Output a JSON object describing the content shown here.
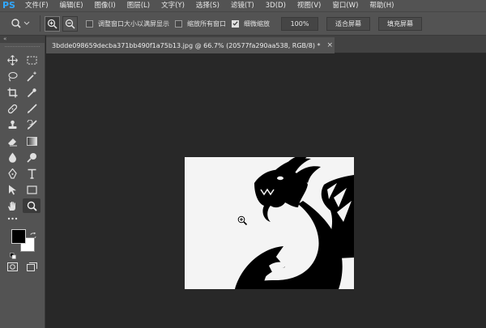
{
  "app": {
    "logo": "PS"
  },
  "menu": {
    "items": [
      "文件(F)",
      "编辑(E)",
      "图像(I)",
      "图层(L)",
      "文字(Y)",
      "选择(S)",
      "滤镜(T)",
      "3D(D)",
      "视图(V)",
      "窗口(W)",
      "帮助(H)"
    ]
  },
  "options": {
    "resize_windows_label": "调整窗口大小以满屏显示",
    "zoom_all_label": "缩放所有窗口",
    "scrubby_label": "细微缩放",
    "zoom_value": "100%",
    "fit_screen_label": "适合屏幕",
    "fill_screen_label": "填充屏幕",
    "resize_windows_checked": false,
    "zoom_all_checked": false,
    "scrubby_checked": true
  },
  "toolbar": {
    "collapse": "«",
    "tools": [
      "move",
      "marquee",
      "lasso",
      "magic-wand",
      "crop",
      "eyedropper",
      "healing",
      "brush",
      "stamp",
      "history-brush",
      "eraser",
      "gradient",
      "blur",
      "dodge",
      "pen",
      "type",
      "path-select",
      "rectangle",
      "hand",
      "zoom",
      "more"
    ],
    "active_tool": "zoom",
    "foreground_color": "#000000",
    "background_color": "#ffffff"
  },
  "document": {
    "tab_title": "3bdde098659decba371bb490f1a75b13.jpg @ 66.7% (20577fa290aa538, RGB/8) *",
    "close": "×",
    "image_subject": "dragon-silhouette"
  }
}
